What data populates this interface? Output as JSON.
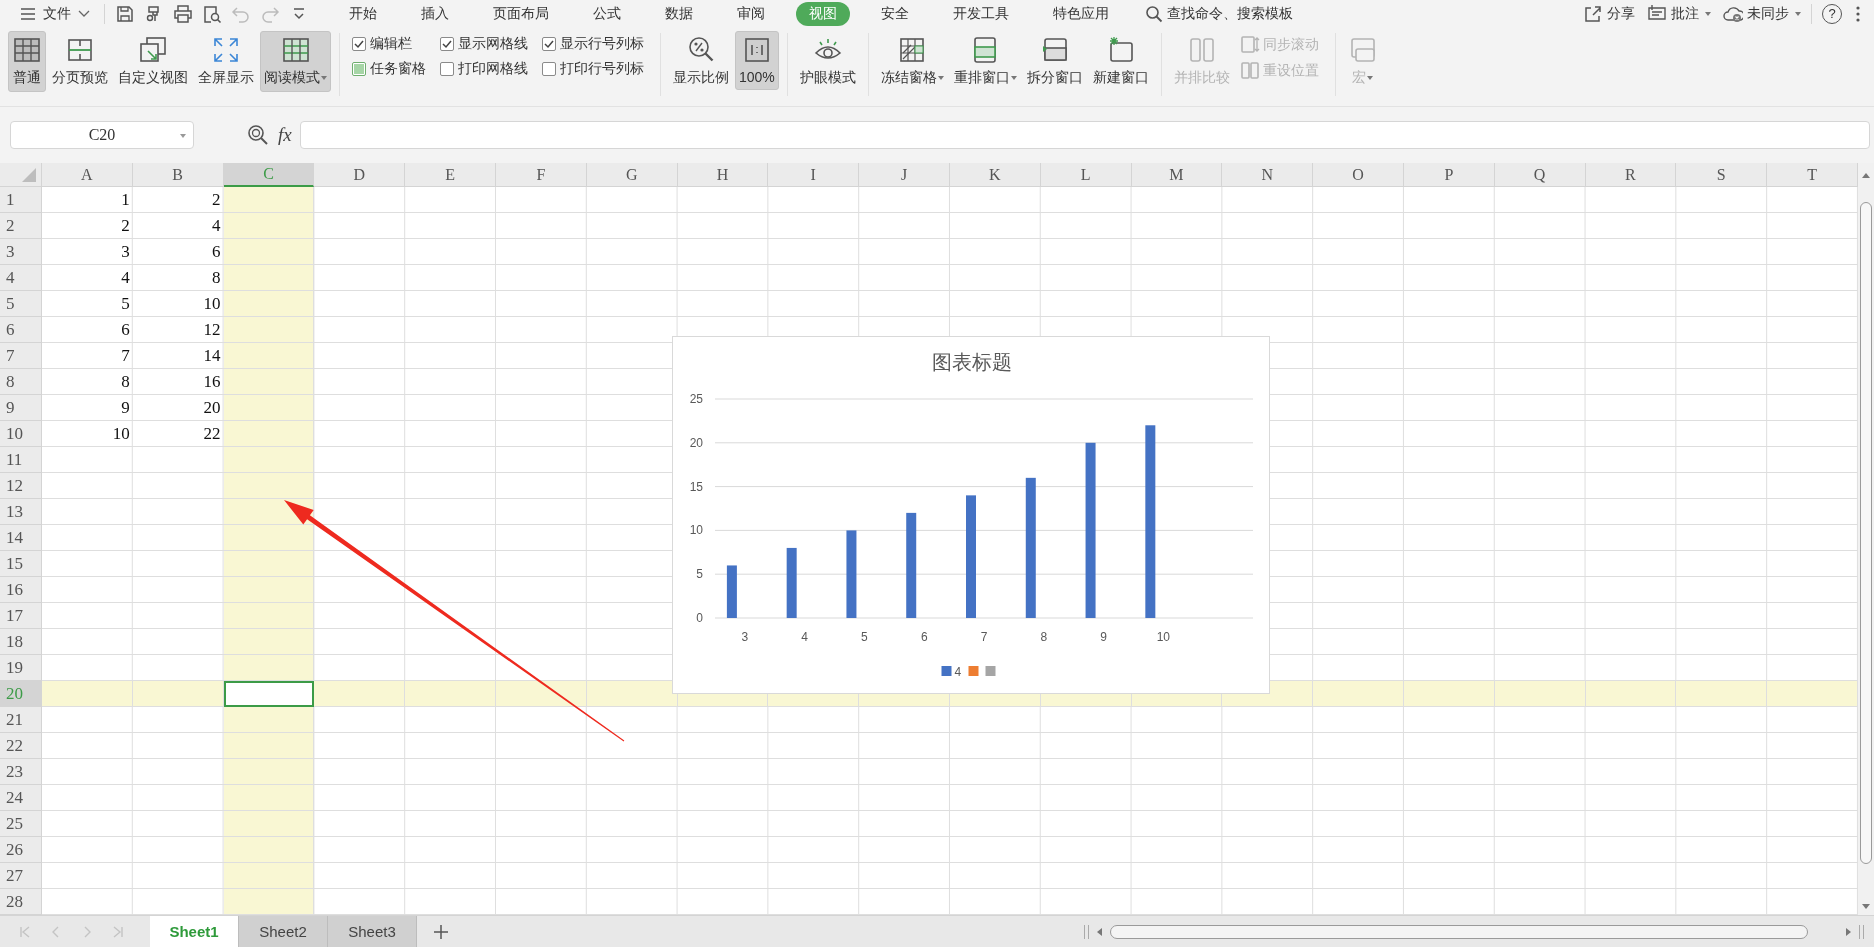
{
  "menu": {
    "file": "文件",
    "quick_access": [
      {
        "disabled": false
      },
      {
        "disabled": false
      },
      {
        "disabled": false
      },
      {
        "disabled": false
      },
      {
        "disabled": true
      },
      {
        "disabled": true
      },
      {
        "disabled": false
      }
    ],
    "tabs": [
      {
        "label": "开始",
        "selected": false
      },
      {
        "label": "插入",
        "selected": false
      },
      {
        "label": "页面布局",
        "selected": false
      },
      {
        "label": "公式",
        "selected": false
      },
      {
        "label": "数据",
        "selected": false
      },
      {
        "label": "审阅",
        "selected": false
      },
      {
        "label": "视图",
        "selected": true
      },
      {
        "label": "安全",
        "selected": false
      },
      {
        "label": "开发工具",
        "selected": false
      },
      {
        "label": "特色应用",
        "selected": false
      }
    ],
    "search": "查找命令、搜索模板",
    "actions": [
      {
        "label": "分享",
        "dropdown": false
      },
      {
        "label": "批注",
        "dropdown": true
      },
      {
        "label": "未同步",
        "dropdown": true
      }
    ],
    "help": "?"
  },
  "ribbon": [
    {
      "items": [
        {
          "kind": "button",
          "label": "普通",
          "selected": true,
          "disabled": false,
          "dropdown": false
        },
        {
          "kind": "button",
          "label": "分页预览",
          "selected": false,
          "disabled": false,
          "dropdown": false
        },
        {
          "kind": "button",
          "label": "自定义视图",
          "selected": false,
          "disabled": false,
          "dropdown": false
        },
        {
          "kind": "button",
          "label": "全屏显示",
          "selected": false,
          "disabled": false,
          "dropdown": false
        },
        {
          "kind": "button",
          "label": "阅读模式",
          "selected": true,
          "disabled": false,
          "dropdown": true
        }
      ]
    },
    {
      "items": [
        {
          "kind": "checks",
          "checks": [
            {
              "label": "编辑栏",
              "checked": true,
              "mixed": false
            },
            {
              "label": "任务窗格",
              "checked": true,
              "mixed": true
            }
          ]
        },
        {
          "kind": "checks",
          "checks": [
            {
              "label": "显示网格线",
              "checked": true,
              "mixed": false
            },
            {
              "label": "打印网格线",
              "checked": false,
              "mixed": false
            }
          ]
        },
        {
          "kind": "checks",
          "checks": [
            {
              "label": "显示行号列标",
              "checked": true,
              "mixed": false
            },
            {
              "label": "打印行号列标",
              "checked": false,
              "mixed": false
            }
          ]
        }
      ]
    },
    {
      "items": [
        {
          "kind": "button",
          "label": "显示比例",
          "selected": false,
          "disabled": false,
          "dropdown": false
        },
        {
          "kind": "button",
          "label": "100%",
          "selected": true,
          "disabled": false,
          "dropdown": false
        }
      ]
    },
    {
      "items": [
        {
          "kind": "button",
          "label": "护眼模式",
          "selected": false,
          "disabled": false,
          "dropdown": false
        }
      ]
    },
    {
      "items": [
        {
          "kind": "button",
          "label": "冻结窗格",
          "selected": false,
          "disabled": false,
          "dropdown": true
        },
        {
          "kind": "button",
          "label": "重排窗口",
          "selected": false,
          "disabled": false,
          "dropdown": true
        },
        {
          "kind": "button",
          "label": "拆分窗口",
          "selected": false,
          "disabled": false,
          "dropdown": false
        },
        {
          "kind": "button",
          "label": "新建窗口",
          "selected": false,
          "disabled": false,
          "dropdown": false
        }
      ]
    },
    {
      "items": [
        {
          "kind": "button",
          "label": "并排比较",
          "selected": false,
          "disabled": true,
          "dropdown": false
        },
        {
          "kind": "smalls",
          "buttons": [
            {
              "label": "同步滚动",
              "disabled": true
            },
            {
              "label": "重设位置",
              "disabled": true
            }
          ]
        }
      ]
    },
    {
      "items": [
        {
          "kind": "button",
          "label": "宏",
          "selected": false,
          "disabled": true,
          "dropdown": true
        }
      ]
    }
  ],
  "formula_bar": {
    "name_box": "C20",
    "function_label": "fx"
  },
  "columns": [
    {
      "label": "A",
      "selected": false
    },
    {
      "label": "B",
      "selected": false
    },
    {
      "label": "C",
      "selected": true
    },
    {
      "label": "D",
      "selected": false
    },
    {
      "label": "E",
      "selected": false
    },
    {
      "label": "F",
      "selected": false
    },
    {
      "label": "G",
      "selected": false
    },
    {
      "label": "H",
      "selected": false
    },
    {
      "label": "I",
      "selected": false
    },
    {
      "label": "J",
      "selected": false
    },
    {
      "label": "K",
      "selected": false
    },
    {
      "label": "L",
      "selected": false
    },
    {
      "label": "M",
      "selected": false
    },
    {
      "label": "N",
      "selected": false
    },
    {
      "label": "O",
      "selected": false
    },
    {
      "label": "P",
      "selected": false
    },
    {
      "label": "Q",
      "selected": false
    },
    {
      "label": "R",
      "selected": false
    },
    {
      "label": "S",
      "selected": false
    },
    {
      "label": "T",
      "selected": false
    }
  ],
  "rows": [
    {
      "label": "1",
      "selected": false,
      "cells": [
        "1",
        "2"
      ]
    },
    {
      "label": "2",
      "selected": false,
      "cells": [
        "2",
        "4"
      ]
    },
    {
      "label": "3",
      "selected": false,
      "cells": [
        "3",
        "6"
      ]
    },
    {
      "label": "4",
      "selected": false,
      "cells": [
        "4",
        "8"
      ]
    },
    {
      "label": "5",
      "selected": false,
      "cells": [
        "5",
        "10"
      ]
    },
    {
      "label": "6",
      "selected": false,
      "cells": [
        "6",
        "12"
      ]
    },
    {
      "label": "7",
      "selected": false,
      "cells": [
        "7",
        "14"
      ]
    },
    {
      "label": "8",
      "selected": false,
      "cells": [
        "8",
        "16"
      ]
    },
    {
      "label": "9",
      "selected": false,
      "cells": [
        "9",
        "20"
      ]
    },
    {
      "label": "10",
      "selected": false,
      "cells": [
        "10",
        "22"
      ]
    },
    {
      "label": "11",
      "selected": false
    },
    {
      "label": "12",
      "selected": false
    },
    {
      "label": "13",
      "selected": false
    },
    {
      "label": "14",
      "selected": false
    },
    {
      "label": "15",
      "selected": false
    },
    {
      "label": "16",
      "selected": false
    },
    {
      "label": "17",
      "selected": false
    },
    {
      "label": "18",
      "selected": false
    },
    {
      "label": "19",
      "selected": false
    },
    {
      "label": "20",
      "selected": true
    },
    {
      "label": "21",
      "selected": false
    },
    {
      "label": "22",
      "selected": false
    },
    {
      "label": "23",
      "selected": false
    },
    {
      "label": "24",
      "selected": false
    },
    {
      "label": "25",
      "selected": false
    },
    {
      "label": "26",
      "selected": false
    },
    {
      "label": "27",
      "selected": false
    },
    {
      "label": "28",
      "selected": false
    }
  ],
  "chart_data": {
    "type": "bar",
    "title": "图表标题",
    "categories": [
      "3",
      "4",
      "5",
      "6",
      "7",
      "8",
      "9",
      "10"
    ],
    "series": [
      {
        "name": "4",
        "color": "#4472c4",
        "values": [
          6,
          8,
          10,
          12,
          14,
          16,
          20,
          22
        ]
      },
      {
        "color": "#ed7d31",
        "values": [
          null,
          null,
          null,
          null,
          null,
          null,
          null,
          null
        ]
      },
      {
        "color": "#a5a5a5",
        "values": [
          null,
          null,
          null,
          null,
          null,
          null,
          null,
          null
        ]
      }
    ],
    "ylim": [
      0,
      25
    ],
    "grid": true,
    "yticks": [
      0,
      5,
      10,
      15,
      20,
      25
    ]
  },
  "sheets": [
    {
      "label": "Sheet1",
      "selected": true
    },
    {
      "label": "Sheet2",
      "selected": false
    },
    {
      "label": "Sheet3",
      "selected": false
    }
  ]
}
